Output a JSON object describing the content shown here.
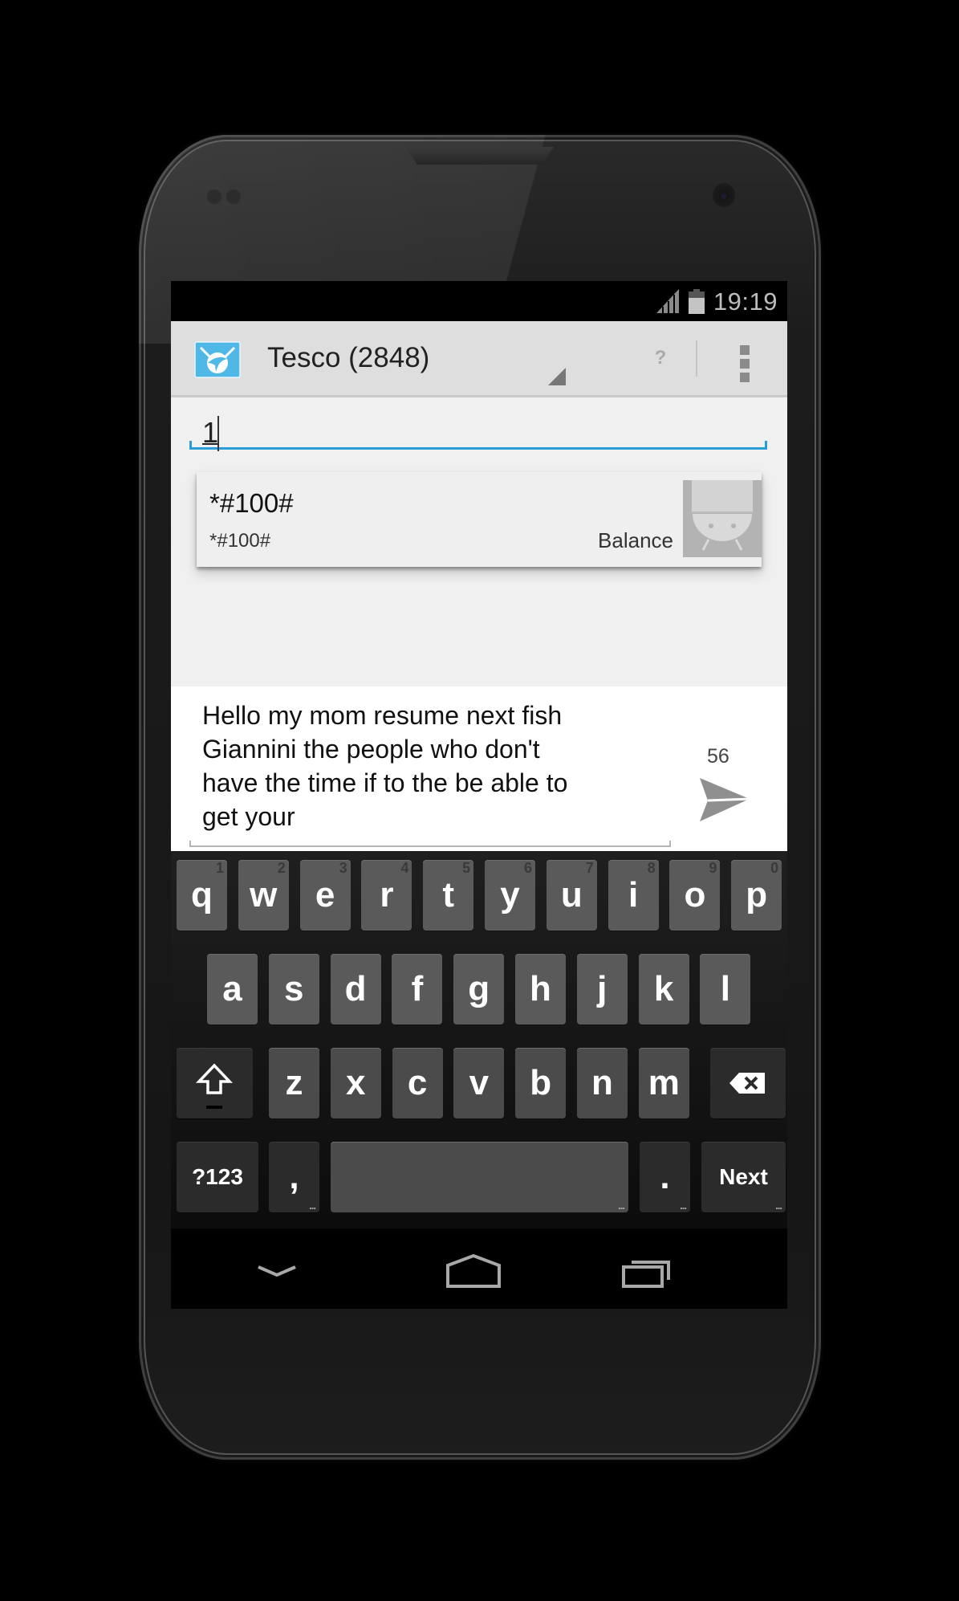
{
  "status_bar": {
    "time": "19:19",
    "icons": [
      "signal-icon",
      "battery-icon"
    ]
  },
  "action_bar": {
    "app_icon": "app-logo-icon",
    "title": "Tesco (2848)",
    "help_label": "?",
    "overflow_icon": "overflow-menu-icon",
    "accent_color": "#2a9ed6"
  },
  "recipient": {
    "value": "1"
  },
  "suggestions": [
    {
      "name": "*#100#",
      "number": "*#100#",
      "label": "Balance",
      "avatar_icon": "default-contact-avatar-icon"
    }
  ],
  "compose": {
    "message": "Hello my mom resume next fish\nGiannini the people who don't\nhave the time if to the be able to\nget your",
    "char_count": "56",
    "send_icon": "send-icon"
  },
  "keyboard": {
    "row1": [
      {
        "ch": "q",
        "hint": "1"
      },
      {
        "ch": "w",
        "hint": "2"
      },
      {
        "ch": "e",
        "hint": "3"
      },
      {
        "ch": "r",
        "hint": "4"
      },
      {
        "ch": "t",
        "hint": "5"
      },
      {
        "ch": "y",
        "hint": "6"
      },
      {
        "ch": "u",
        "hint": "7"
      },
      {
        "ch": "i",
        "hint": "8"
      },
      {
        "ch": "o",
        "hint": "9"
      },
      {
        "ch": "p",
        "hint": "0"
      }
    ],
    "row2": [
      "a",
      "s",
      "d",
      "f",
      "g",
      "h",
      "j",
      "k",
      "l"
    ],
    "row3": [
      "z",
      "x",
      "c",
      "v",
      "b",
      "n",
      "m"
    ],
    "shift_icon": "shift-icon",
    "backspace_icon": "backspace-icon",
    "symbols_label": "?123",
    "comma_label": ",",
    "period_label": ".",
    "action_label": "Next",
    "more_hint": "..."
  },
  "nav_bar": {
    "back_icon": "back-down-chevron-icon",
    "home_icon": "home-icon",
    "recents_icon": "recent-apps-icon"
  }
}
